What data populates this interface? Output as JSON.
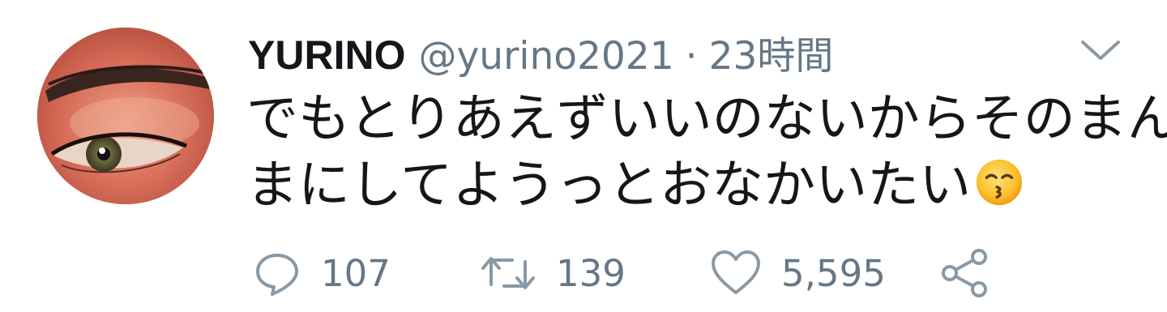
{
  "tweet": {
    "display_name": "YURINO",
    "handle": "@yurino2021",
    "separator": "·",
    "time": "23時間",
    "text_lines": [
      "でもとりあえずいいのないからそのまん",
      "まにしてようっとおなかいたい"
    ],
    "emoji": "kissing-face-with-smiling-eyes",
    "avatar": "avatar-eye-closeup"
  },
  "actions": {
    "reply": {
      "icon": "reply-icon",
      "count": "107"
    },
    "retweet": {
      "icon": "retweet-icon",
      "count": "139"
    },
    "like": {
      "icon": "heart-icon",
      "count": "5,595"
    },
    "share": {
      "icon": "share-icon"
    }
  },
  "colors": {
    "text_primary": "#14171a",
    "text_secondary": "#657786",
    "background": "#ffffff"
  }
}
